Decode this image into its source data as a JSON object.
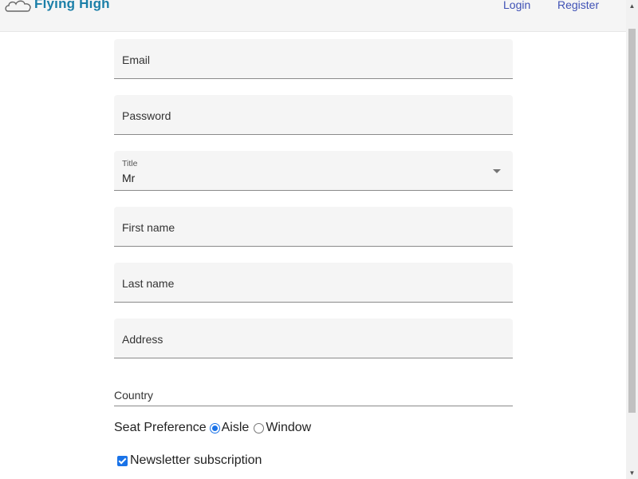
{
  "header": {
    "logo_text": "Flying High",
    "login_label": "Login",
    "register_label": "Register"
  },
  "form": {
    "email_label": "Email",
    "password_label": "Password",
    "title": {
      "label": "Title",
      "selected_value": "Mr"
    },
    "first_name_label": "First name",
    "last_name_label": "Last name",
    "address_label": "Address",
    "country_label": "Country",
    "seat_preference": {
      "label": "Seat Preference",
      "options": [
        "Aisle",
        "Window"
      ],
      "selected": "Aisle"
    },
    "newsletter": {
      "label": "Newsletter subscription",
      "checked": true
    }
  },
  "colors": {
    "accent": "#3f51b5",
    "logo": "#1b7fa8",
    "control_blue": "#1a73e8",
    "field_background": "#f5f5f5"
  },
  "icons": {
    "logo": "cloud-icon",
    "dropdown": "triangle-down-icon",
    "scroll_up": "triangle-up-icon",
    "scroll_down": "triangle-down-icon"
  }
}
